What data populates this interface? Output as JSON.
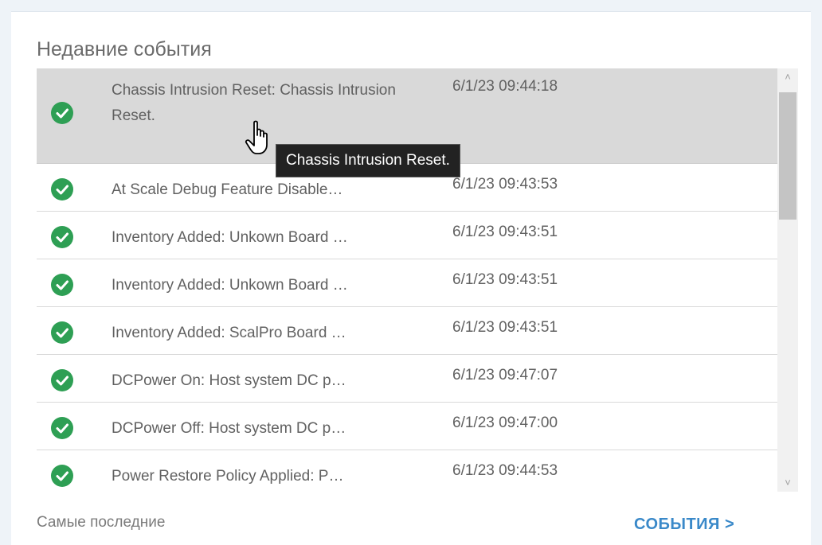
{
  "panel": {
    "title": "Недавние события",
    "footer_left": "Самые последние",
    "events_link": "СОБЫТИЯ >"
  },
  "events": [
    {
      "message": "Chassis Intrusion Reset: Chassis Intrusion Reset.",
      "time": "6/1/23 09:44:18",
      "status": "ok",
      "selected": true
    },
    {
      "message": "At Scale Debug Feature Disable…",
      "time": "6/1/23 09:43:53",
      "status": "ok"
    },
    {
      "message": "Inventory Added: Unkown Board …",
      "time": "6/1/23 09:43:51",
      "status": "ok"
    },
    {
      "message": "Inventory Added: Unkown Board …",
      "time": "6/1/23 09:43:51",
      "status": "ok"
    },
    {
      "message": "Inventory Added: ScalPro Board …",
      "time": "6/1/23 09:43:51",
      "status": "ok"
    },
    {
      "message": "DCPower On: Host system DC p…",
      "time": "6/1/23 09:47:07",
      "status": "ok"
    },
    {
      "message": "DCPower Off: Host system DC p…",
      "time": "6/1/23 09:47:00",
      "status": "ok"
    },
    {
      "message": "Power Restore Policy Applied: P…",
      "time": "6/1/23 09:44:53",
      "status": "ok"
    }
  ],
  "tooltip": {
    "text": "Chassis Intrusion Reset."
  },
  "icons": {
    "status": "check-circle-icon",
    "scroll_up": "chevron-up-icon",
    "scroll_down": "chevron-down-icon",
    "cursor": "hand-pointer-icon"
  },
  "colors": {
    "status_ok": "#2e9f54",
    "link": "#3a89c9",
    "selected_row": "#d9d9d9"
  }
}
